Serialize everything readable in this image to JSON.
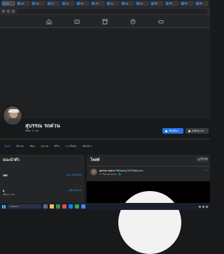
{
  "browser": {
    "tabs": [
      {
        "label": "(6)"
      },
      {
        "label": "(6)"
      },
      {
        "label": "(6)"
      },
      {
        "label": "(6)"
      },
      {
        "label": "(6)"
      },
      {
        "label": "(6)"
      },
      {
        "label": "(6)"
      },
      {
        "label": "(6)"
      },
      {
        "label": "(6)"
      },
      {
        "label": "(6)"
      },
      {
        "label": "ทีม"
      },
      {
        "label": "ทีม"
      },
      {
        "label": "ทีม"
      },
      {
        "label": "ทีม"
      }
    ]
  },
  "fb_nav": {
    "icons": [
      "home-icon",
      "video-icon",
      "marketplace-icon",
      "groups-icon",
      "gaming-icon"
    ]
  },
  "profile": {
    "name": "สุบรรณ รถด่วน",
    "friends": "เพื่อน 17 คน",
    "primary_button": "เพิ่มเพื่อน",
    "secondary_button": "ส่งข้อความ",
    "tabs": [
      "โพสต์",
      "เกี่ยวกับ",
      "เพื่อน",
      "รูปภาพ",
      "วิดีโอ",
      "การเช็คอิน",
      "เพิ่มเติม"
    ]
  },
  "intro": {
    "title": "แนะนำตัว",
    "rows": [
      {
        "label": "เพศ",
        "link": "ดูประวัติเพิ่มเติม"
      },
      {
        "label": "ผ",
        "link": "ดูเพื่อนทั้งหมด"
      }
    ],
    "sub": "เพื่อน 17 คน"
  },
  "posts": {
    "title": "โพสต์",
    "filter_label": "ตัวกรอง",
    "author": "สุบรรณ รถด่วน",
    "action": "ได้อัปเดตรูปโปรไฟล์ของเขา",
    "time": "17 สิงหาคม 2023 · 🌐"
  },
  "taskbar": {
    "search_placeholder": "Search"
  },
  "colors": {
    "accent": "#2374e1",
    "link": "#2d88ff",
    "surface": "#242526",
    "background": "#18191a"
  }
}
